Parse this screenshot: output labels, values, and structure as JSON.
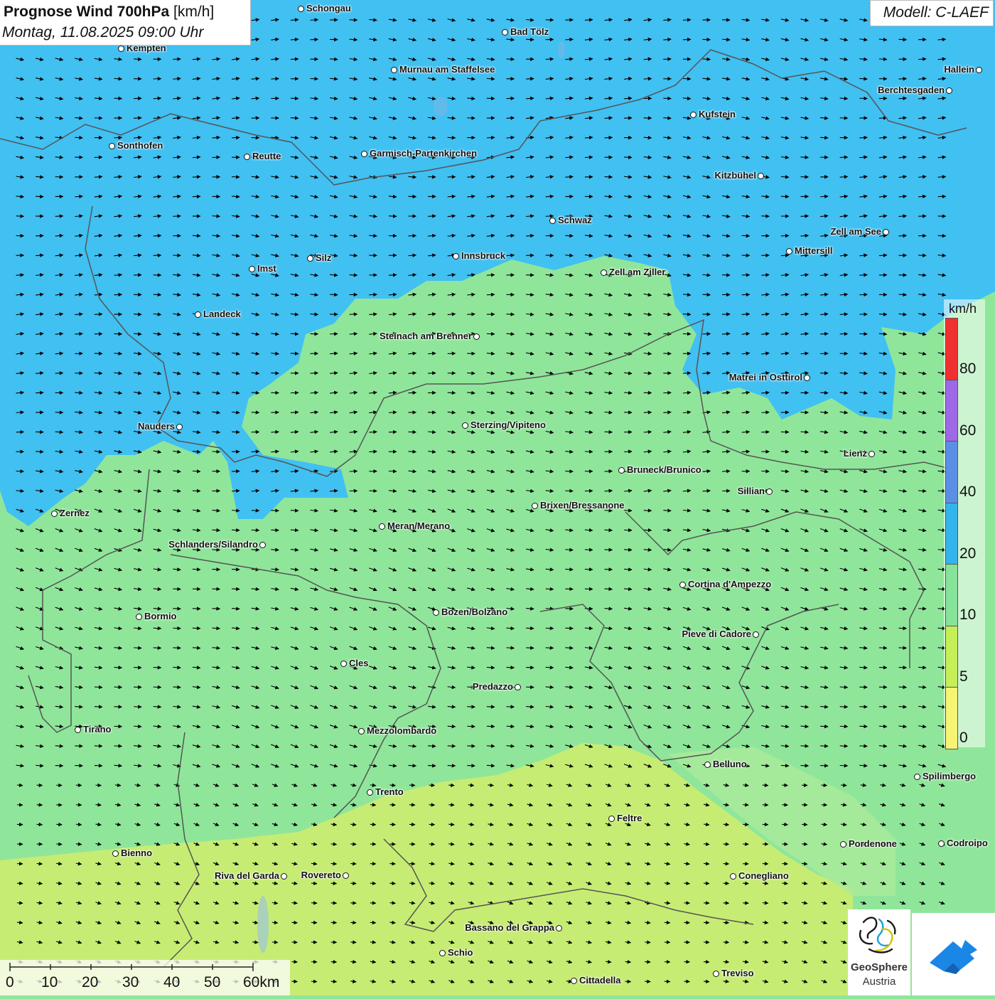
{
  "header": {
    "title_bold": "Prognose Wind 700hPa",
    "title_unit": "[km/h]",
    "subtitle": "Montag, 11.08.2025 09:00 Uhr",
    "model": "Modell: C-LAEF"
  },
  "legend": {
    "unit": "km/h",
    "bands": [
      {
        "from": 80,
        "to": 100,
        "color": "#f0302e"
      },
      {
        "from": 60,
        "to": 80,
        "color": "#9f68e6"
      },
      {
        "from": 40,
        "to": 60,
        "color": "#5b8fe5"
      },
      {
        "from": 20,
        "to": 40,
        "color": "#33b4ec"
      },
      {
        "from": 10,
        "to": 20,
        "color": "#86e39a"
      },
      {
        "from": 5,
        "to": 10,
        "color": "#c5ef56"
      },
      {
        "from": 0,
        "to": 5,
        "color": "#f6f472"
      }
    ],
    "labels": [
      "80",
      "60",
      "40",
      "20",
      "10",
      "5",
      "0"
    ]
  },
  "scale_bar": {
    "labels": [
      "0",
      "10",
      "20",
      "30",
      "40",
      "50",
      "60km"
    ]
  },
  "logos": {
    "geosphere_name": "GeoSphere",
    "geosphere_sub": "Austria"
  },
  "map": {
    "wind_direction": "west to east",
    "field_colors": {
      "over_20": "#41c0f2",
      "10_to_20": "#8fe69a",
      "5_to_10": "#c7ec74"
    },
    "cities": [
      {
        "name": "Schongau"
      },
      {
        "name": "Bad Tölz"
      },
      {
        "name": "Kempten"
      },
      {
        "name": "Murnau am Staffelsee"
      },
      {
        "name": "Hallein"
      },
      {
        "name": "Berchtesgaden"
      },
      {
        "name": "Kufstein"
      },
      {
        "name": "Sonthofen"
      },
      {
        "name": "Reutte"
      },
      {
        "name": "Garmisch-Partenkirchen"
      },
      {
        "name": "Kitzbühel"
      },
      {
        "name": "Schwaz"
      },
      {
        "name": "Zell am See"
      },
      {
        "name": "Mittersill"
      },
      {
        "name": "Innsbruck"
      },
      {
        "name": "Silz"
      },
      {
        "name": "Imst"
      },
      {
        "name": "Zell am Ziller"
      },
      {
        "name": "Landeck"
      },
      {
        "name": "Steinach am Brenner"
      },
      {
        "name": "Matrei in Osttirol"
      },
      {
        "name": "Nauders"
      },
      {
        "name": "Sterzing/Vipiteno"
      },
      {
        "name": "Lienz"
      },
      {
        "name": "Bruneck/Brunico"
      },
      {
        "name": "Sillian"
      },
      {
        "name": "Zernez"
      },
      {
        "name": "Brixen/Bressanone"
      },
      {
        "name": "Meran/Merano"
      },
      {
        "name": "Schlanders/Silandro"
      },
      {
        "name": "Cortina d'Ampezzo"
      },
      {
        "name": "Bozen/Bolzano"
      },
      {
        "name": "Bormio"
      },
      {
        "name": "Pieve di Cadore"
      },
      {
        "name": "Cles"
      },
      {
        "name": "Predazzo"
      },
      {
        "name": "Tirano"
      },
      {
        "name": "Mezzolombardo"
      },
      {
        "name": "Belluno"
      },
      {
        "name": "Spilimbergo"
      },
      {
        "name": "Trento"
      },
      {
        "name": "Feltre"
      },
      {
        "name": "Pordenone"
      },
      {
        "name": "Codroipo"
      },
      {
        "name": "Bienno"
      },
      {
        "name": "Riva del Garda"
      },
      {
        "name": "Rovereto"
      },
      {
        "name": "Conegliano"
      },
      {
        "name": "Bassano del Grappa"
      },
      {
        "name": "Schio"
      },
      {
        "name": "Treviso"
      },
      {
        "name": "Cittadella"
      }
    ]
  }
}
